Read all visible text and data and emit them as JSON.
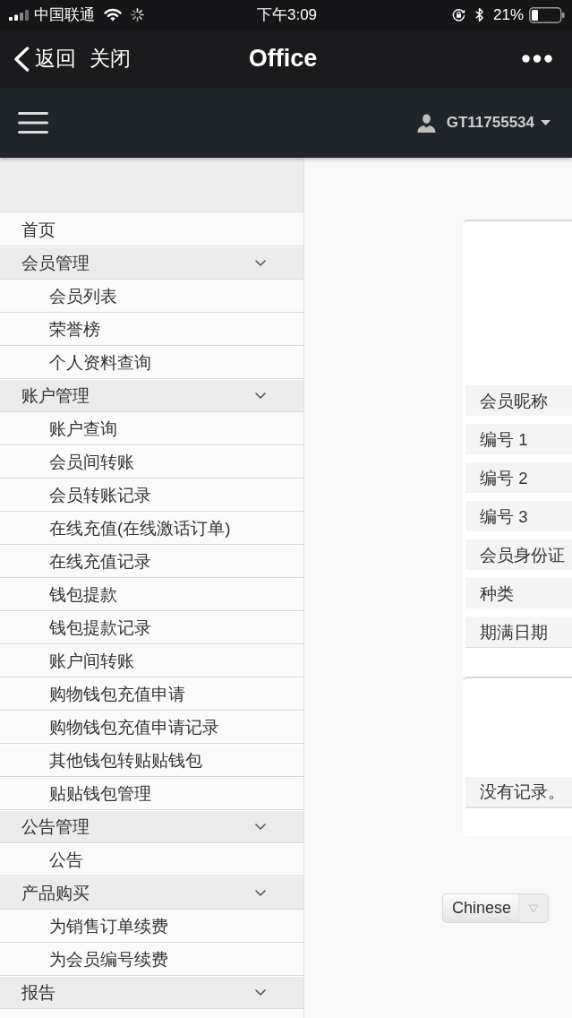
{
  "status_bar": {
    "carrier": "中国联通",
    "time": "下午3:09",
    "battery": "21%"
  },
  "nav_bar": {
    "back": "返回",
    "close": "关闭",
    "title": "Office"
  },
  "header": {
    "username": "GT11755534"
  },
  "sidebar": {
    "items": [
      {
        "kind": "link",
        "label": "首页"
      },
      {
        "kind": "group",
        "label": "会员管理",
        "expanded": true,
        "children": [
          {
            "label": "会员列表"
          },
          {
            "label": "荣誉榜"
          },
          {
            "label": "个人资料查询"
          }
        ]
      },
      {
        "kind": "group",
        "label": "账户管理",
        "expanded": true,
        "children": [
          {
            "label": "账户查询"
          },
          {
            "label": "会员间转账"
          },
          {
            "label": "会员转账记录"
          },
          {
            "label": "在线充值(在线激话订单)"
          },
          {
            "label": "在线充值记录"
          },
          {
            "label": "钱包提款"
          },
          {
            "label": "钱包提款记录"
          },
          {
            "label": "账户间转账"
          },
          {
            "label": "购物钱包充值申请"
          },
          {
            "label": "购物钱包充值申请记录"
          },
          {
            "label": "其他钱包转贴贴钱包"
          },
          {
            "label": "贴贴钱包管理"
          }
        ]
      },
      {
        "kind": "group",
        "label": "公告管理",
        "expanded": true,
        "children": [
          {
            "label": "公告"
          }
        ]
      },
      {
        "kind": "group",
        "label": "产品购买",
        "expanded": true,
        "children": [
          {
            "label": "为销售订单续费"
          },
          {
            "label": "为会员编号续费"
          }
        ]
      },
      {
        "kind": "group",
        "label": "报告",
        "expanded": true
      }
    ]
  },
  "member_card": {
    "fields": [
      "会员昵称",
      "编号 1",
      "编号 2",
      "编号 3",
      "会员身份证",
      "种类",
      "期满日期"
    ]
  },
  "records_card": {
    "empty_message": "没有记录。"
  },
  "language_select": {
    "value": "Chinese"
  }
}
